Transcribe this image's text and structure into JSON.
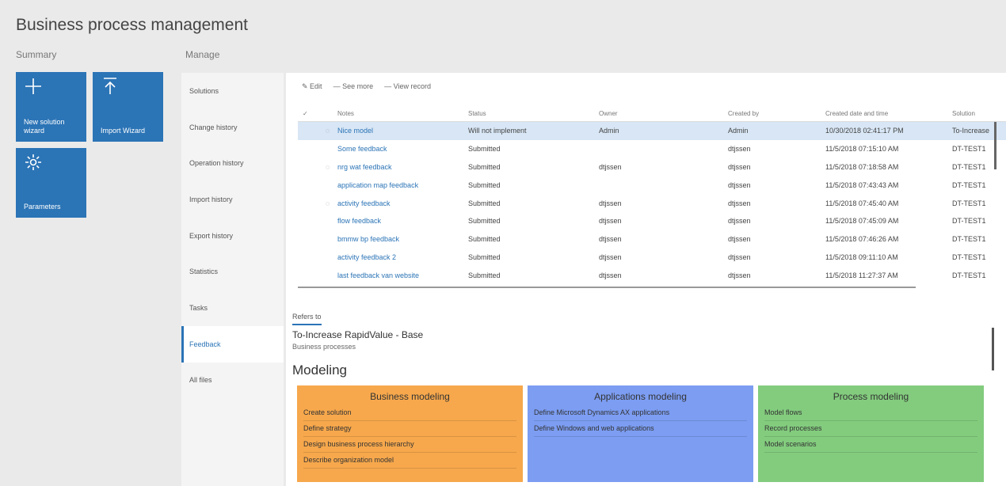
{
  "page": {
    "title": "Business process management"
  },
  "summary": {
    "label": "Summary",
    "tiles": [
      {
        "icon": "plus-icon",
        "label": "New solution wizard"
      },
      {
        "icon": "upload-icon",
        "label": "Import Wizard"
      },
      {
        "icon": "gear-icon",
        "label": "Parameters"
      }
    ]
  },
  "manage": {
    "label": "Manage",
    "items": [
      "Solutions",
      "Change history",
      "Operation history",
      "Import history",
      "Export history",
      "Statistics",
      "Tasks",
      "Feedback",
      "All files"
    ],
    "active": "Feedback"
  },
  "toolbar": {
    "edit": "Edit",
    "see_more": "See more",
    "view_record": "View record"
  },
  "grid": {
    "columns": [
      "Notes",
      "Status",
      "Owner",
      "Created by",
      "Created date and time",
      "Solution"
    ],
    "rows": [
      {
        "icon": "bulb-icon",
        "name": "Nice model",
        "status": "Will not implement",
        "owner": "Admin",
        "created_by": "Admin",
        "date": "10/30/2018 02:41:17 PM",
        "solution": "To-Increase",
        "selected": true
      },
      {
        "icon": "",
        "name": "Some feedback",
        "status": "Submitted",
        "owner": "",
        "created_by": "dtjssen",
        "date": "11/5/2018 07:15:10 AM",
        "solution": "DT-TEST1",
        "selected": false
      },
      {
        "icon": "bulb-icon",
        "name": "nrg wat feedback",
        "status": "Submitted",
        "owner": "dtjssen",
        "created_by": "dtjssen",
        "date": "11/5/2018 07:18:58 AM",
        "solution": "DT-TEST1",
        "selected": false
      },
      {
        "icon": "",
        "name": "application map feedback",
        "status": "Submitted",
        "owner": "",
        "created_by": "dtjssen",
        "date": "11/5/2018 07:43:43 AM",
        "solution": "DT-TEST1",
        "selected": false
      },
      {
        "icon": "bulb-icon",
        "name": "activity feedback",
        "status": "Submitted",
        "owner": "dtjssen",
        "created_by": "dtjssen",
        "date": "11/5/2018 07:45:40 AM",
        "solution": "DT-TEST1",
        "selected": false
      },
      {
        "icon": "",
        "name": "flow feedback",
        "status": "Submitted",
        "owner": "dtjssen",
        "created_by": "dtjssen",
        "date": "11/5/2018 07:45:09 AM",
        "solution": "DT-TEST1",
        "selected": false
      },
      {
        "icon": "",
        "name": "bmmw bp feedback",
        "status": "Submitted",
        "owner": "dtjssen",
        "created_by": "dtjssen",
        "date": "11/5/2018 07:46:26 AM",
        "solution": "DT-TEST1",
        "selected": false
      },
      {
        "icon": "",
        "name": "activity feedback 2",
        "status": "Submitted",
        "owner": "dtjssen",
        "created_by": "dtjssen",
        "date": "11/5/2018 09:11:10 AM",
        "solution": "DT-TEST1",
        "selected": false
      },
      {
        "icon": "",
        "name": "last feedback van website",
        "status": "Submitted",
        "owner": "dtjssen",
        "created_by": "dtjssen",
        "date": "11/5/2018 11:27:37 AM",
        "solution": "DT-TEST1",
        "selected": false
      }
    ]
  },
  "refers": {
    "tab": "Refers to",
    "title": "To-Increase RapidValue - Base",
    "subtitle": "Business processes"
  },
  "modeling": {
    "title": "Modeling",
    "columns": [
      {
        "title": "Business modeling",
        "color": "#f7a84c",
        "items": [
          "Create solution",
          "Define strategy",
          "Design business process hierarchy",
          "Describe organization model"
        ]
      },
      {
        "title": "Applications modeling",
        "color": "#7c9df2",
        "items": [
          "Define Microsoft Dynamics AX applications",
          "Define Windows and web applications"
        ]
      },
      {
        "title": "Process modeling",
        "color": "#83cc7e",
        "items": [
          "Model flows",
          "Record processes",
          "Model scenarios"
        ]
      }
    ]
  }
}
